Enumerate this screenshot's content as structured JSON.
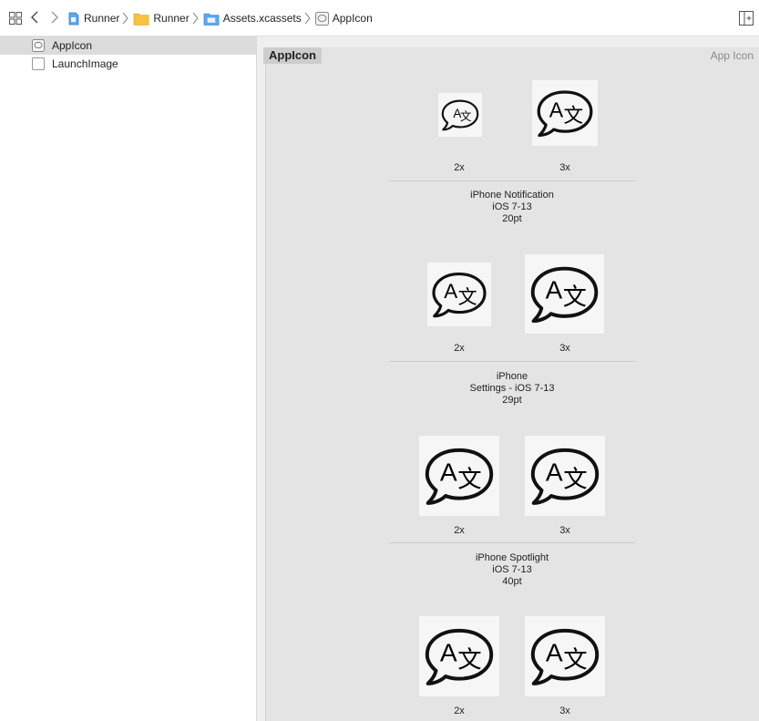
{
  "breadcrumb": [
    {
      "label": "Runner",
      "icon": "project-file-icon"
    },
    {
      "label": "Runner",
      "icon": "folder-icon"
    },
    {
      "label": "Assets.xcassets",
      "icon": "asset-catalog-icon"
    },
    {
      "label": "AppIcon",
      "icon": "app-icon-set-icon"
    }
  ],
  "sidebar": {
    "items": [
      {
        "label": "AppIcon",
        "icon": "app-icon-set-icon",
        "selected": true
      },
      {
        "label": "LaunchImage",
        "icon": "image-set-icon",
        "selected": false
      }
    ]
  },
  "asset": {
    "name": "AppIcon",
    "type_label": "App Icon"
  },
  "groups": [
    {
      "scales": [
        "2x",
        "3x"
      ],
      "caption": [
        "iPhone Notification",
        "iOS 7-13",
        "20pt"
      ]
    },
    {
      "scales": [
        "2x",
        "3x"
      ],
      "caption": [
        "iPhone",
        "Settings - iOS 7-13",
        "29pt"
      ]
    },
    {
      "scales": [
        "2x",
        "3x"
      ],
      "caption": [
        "iPhone Spotlight",
        "iOS 7-13",
        "40pt"
      ]
    },
    {
      "scales": [
        "2x",
        "3x"
      ],
      "caption": []
    }
  ],
  "icon_glyph": {
    "latin": "A",
    "cjk": "文"
  },
  "colors": {
    "folder": "#f5c242",
    "blue_icon": "#3b8ed8",
    "selection": "#dcdcdc"
  }
}
